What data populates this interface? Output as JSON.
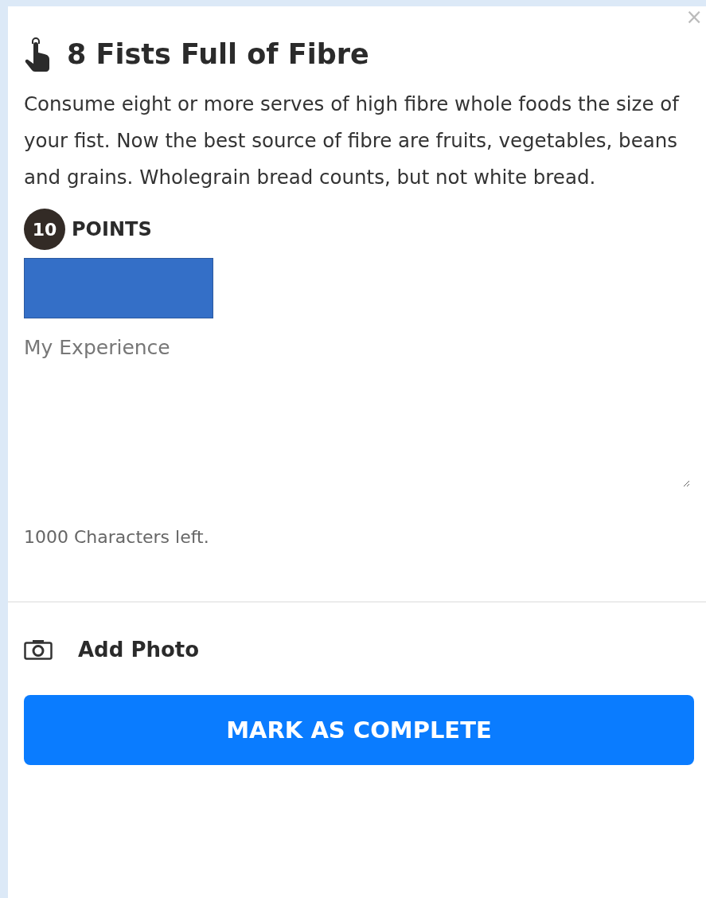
{
  "close": {
    "label": "×"
  },
  "title": "8 Fists Full of Fibre",
  "description": "Consume eight or more serves of high fibre whole foods the size of your fist. Now the best source of fibre are fruits, vegetables, beans and grains. Wholegrain bread counts, but not white bread.",
  "points": {
    "value": "10",
    "label": "POINTS"
  },
  "experience": {
    "placeholder": "My Experience"
  },
  "characters_left": "1000 Characters left.",
  "add_photo": {
    "label": "Add Photo"
  },
  "complete_button": {
    "label": "MARK AS COMPLETE"
  }
}
